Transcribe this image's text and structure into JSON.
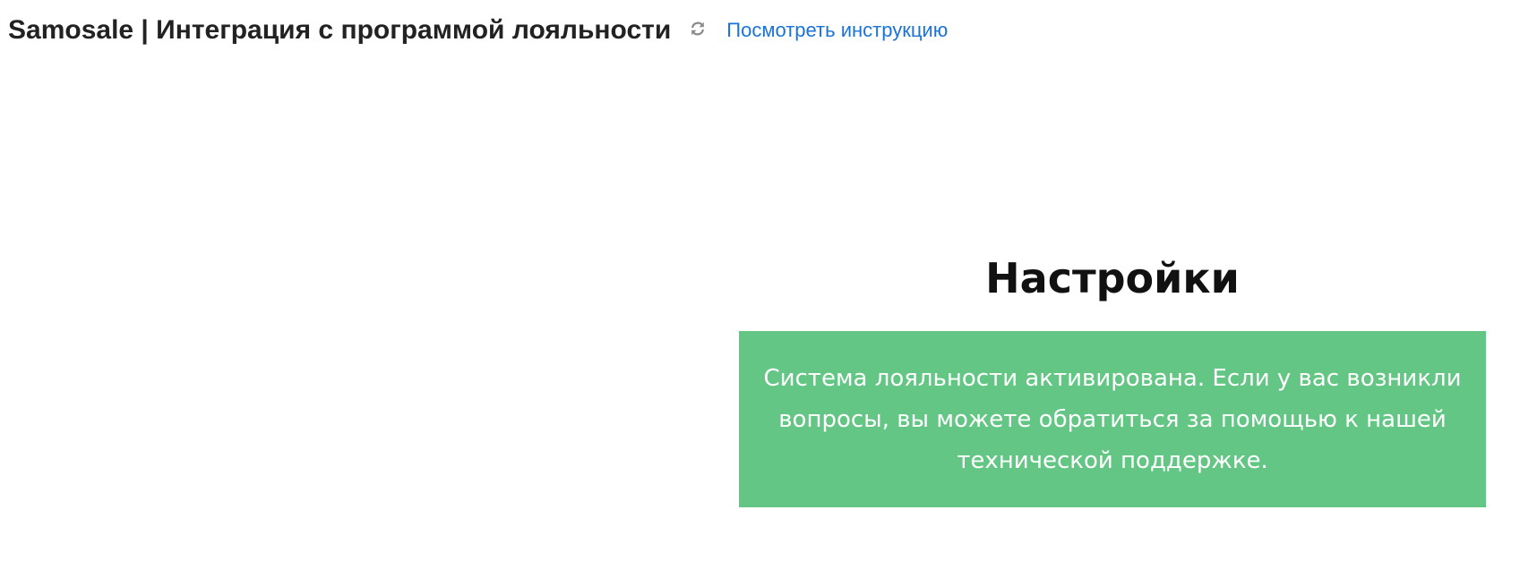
{
  "header": {
    "title": "Samosale | Интеграция с программой лояльности",
    "reload_icon": "refresh-icon",
    "help_link": "Посмотреть инструкцию"
  },
  "settings": {
    "heading": "Настройки",
    "status_message": "Система лояльности активирована. Если у вас возникли вопросы, вы можете обратиться за помощью к нашей технической поддержке."
  },
  "colors": {
    "title_text": "#222222",
    "link": "#1a73d9",
    "success_banner": "#64c684",
    "banner_text": "#ffffff",
    "icon_gray": "#8a8a8a"
  }
}
